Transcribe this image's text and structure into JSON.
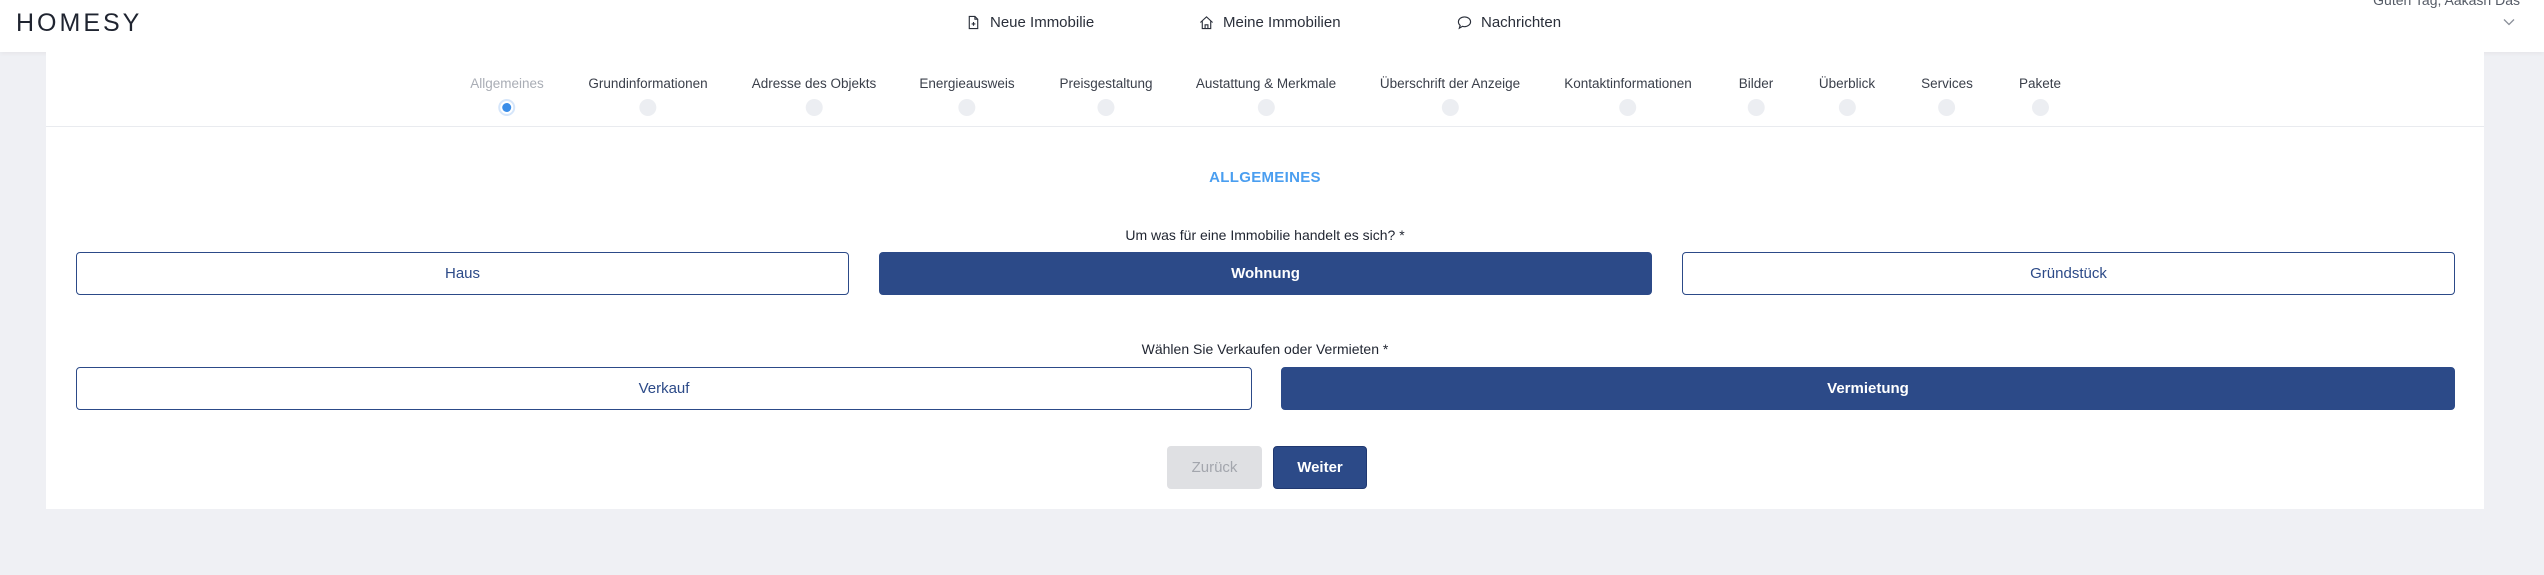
{
  "header": {
    "logo": "HOMESY",
    "nav": [
      {
        "label": "Neue Immobilie",
        "icon": "document-plus-icon"
      },
      {
        "label": "Meine Immobilien",
        "icon": "home-icon"
      },
      {
        "label": "Nachrichten",
        "icon": "chat-bubble-icon"
      }
    ],
    "greeting": "Guten Tag, Aakash Das"
  },
  "steps": [
    {
      "label": "Allgemeines",
      "active": true
    },
    {
      "label": "Grundinformationen",
      "active": false
    },
    {
      "label": "Adresse des Objekts",
      "active": false
    },
    {
      "label": "Energieausweis",
      "active": false
    },
    {
      "label": "Preisgestaltung",
      "active": false
    },
    {
      "label": "Austattung & Merkmale",
      "active": false
    },
    {
      "label": "Überschrift der Anzeige",
      "active": false
    },
    {
      "label": "Kontaktinformationen",
      "active": false
    },
    {
      "label": "Bilder",
      "active": false
    },
    {
      "label": "Überblick",
      "active": false
    },
    {
      "label": "Services",
      "active": false
    },
    {
      "label": "Pakete",
      "active": false
    }
  ],
  "form": {
    "section_title": "ALLGEMEINES",
    "property_type": {
      "question": "Um was für eine Immobilie handelt es sich? *",
      "options": [
        "Haus",
        "Wohnung",
        "Gründstück"
      ],
      "selected": "Wohnung"
    },
    "offer_type": {
      "question": "Wählen Sie Verkaufen oder Vermieten *",
      "options": [
        "Verkauf",
        "Vermietung"
      ],
      "selected": "Vermietung"
    },
    "back_label": "Zurück",
    "next_label": "Weiter"
  },
  "colors": {
    "primary": "#2c4a88",
    "accent": "#4a9ef0",
    "background": "#eff0f4"
  }
}
